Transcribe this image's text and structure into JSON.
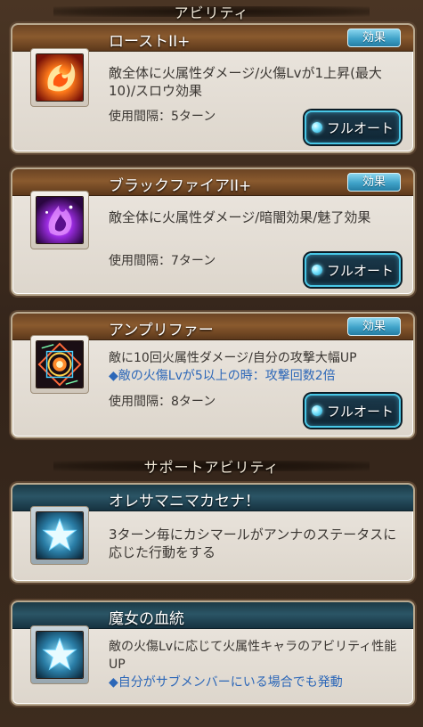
{
  "sections": {
    "abilities_title": "アビリティ",
    "support_title": "サポートアビリティ"
  },
  "abilities": [
    {
      "name": "ローストII+",
      "badge": "効果",
      "description": "敵全体に火属性ダメージ/火傷Lvが1上昇(最大10)/スロウ効果",
      "note": "",
      "cooldown": "使用間隔：5ターン",
      "button": "フルオート",
      "icon": "fire-swirl-icon"
    },
    {
      "name": "ブラックファイアII+",
      "badge": "効果",
      "description": "敵全体に火属性ダメージ/暗闇効果/魅了効果",
      "note": "",
      "cooldown": "使用間隔：7ターン",
      "button": "フルオート",
      "icon": "purple-flame-icon"
    },
    {
      "name": "アンプリファー",
      "badge": "効果",
      "description": "敵に10回火属性ダメージ/自分の攻撃大幅UP",
      "note": "◆敵の火傷Lvが5以上の時：攻撃回数2倍",
      "cooldown": "使用間隔：8ターン",
      "button": "フルオート",
      "icon": "magic-circle-icon"
    }
  ],
  "support_abilities": [
    {
      "name": "オレサマニマカセナ！",
      "description": "3ターン毎にカシマールがアンナのステータスに応じた行動をする",
      "note": "",
      "icon": "star-icon"
    },
    {
      "name": "魔女の血統",
      "description": "敵の火傷Lvに応じて火属性キャラのアビリティ性能UP",
      "note": "◆自分がサブメンバーにいる場合でも発動",
      "icon": "star-icon"
    }
  ],
  "colors": {
    "accent_cyan": "#48c7e6",
    "ability_bar": "#8a5a2e",
    "support_bar": "#2b5566",
    "note_blue": "#2c67b8"
  }
}
